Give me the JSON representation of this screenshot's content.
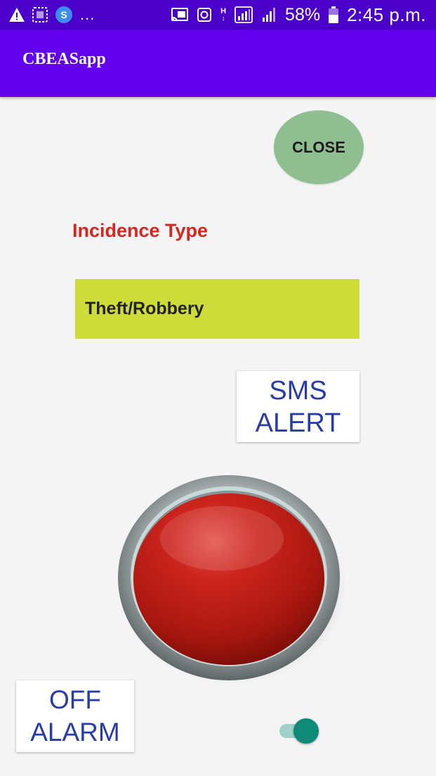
{
  "status_bar": {
    "overflow_dots": "...",
    "signal_type": "H",
    "battery_percent": "58%",
    "time": "2:45 p.m.",
    "icons": [
      "warning-icon",
      "screenshot-icon",
      "s-app-icon",
      "cast-icon",
      "sync-icon",
      "hspa-icon",
      "signal-icon",
      "signal-icon",
      "battery-icon"
    ]
  },
  "app_bar": {
    "title": "CBEASapp"
  },
  "close_button": {
    "label": "CLOSE",
    "color": "#8fbf90"
  },
  "incidence": {
    "label": "Incidence Type",
    "selected": "Theft/Robbery",
    "label_color": "#d6261f",
    "select_color": "#cddc39"
  },
  "sms_alert_button": {
    "line1": "SMS",
    "line2": "ALERT",
    "text_color": "#283ca8"
  },
  "panic_button": {
    "icon": "panic-button-icon",
    "color": "#c0201a"
  },
  "off_alarm_button": {
    "line1": "OFF",
    "line2": "ALARM",
    "text_color": "#283ca8"
  },
  "alarm_toggle": {
    "state": "on",
    "accent": "#0d8a78"
  }
}
